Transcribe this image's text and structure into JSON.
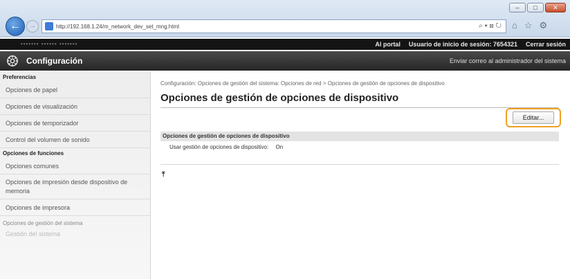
{
  "browser": {
    "url": "http://192.168.1.24/m_network_dev_set_mng.html",
    "addr_tools": "⌕ ▾ ⊠ ↻",
    "back_icon": "back-arrow-icon",
    "window_buttons": [
      "–",
      "□",
      "✕"
    ]
  },
  "topbar": {
    "device_name": "•••••••  •••••• •••••••",
    "portal_link": "Al portal",
    "login_user_label": "Usuario de inicio de sesión:",
    "login_user_value": "7654321",
    "logout_link": "Cerrar sesión"
  },
  "header": {
    "title": "Configuración",
    "mail_link": "Enviar correo al administrador del sistema"
  },
  "sidebar": {
    "group1": "Preferencias",
    "items1": [
      "Opciones de papel",
      "Opciones de visualización",
      "Opciones de temporizador",
      "Control del volumen de sonido"
    ],
    "group2": "Opciones de funciones",
    "items2": [
      "Opciones comunes",
      "Opciones de impresión desde dispositivo de memoria",
      "Opciones de impresora"
    ],
    "group3": "Opciones de gestión del sistema",
    "faded_item": "Gestión del sistema"
  },
  "main": {
    "breadcrumb": "Configuración: Opciones de gestión del sistema: Opciones de red > Opciones de gestión de opciones de dispositivo",
    "title": "Opciones de gestión de opciones de dispositivo",
    "edit_button": "Editar...",
    "section_title": "Opciones de gestión de opciones de dispositivo",
    "setting_label": "Usar gestión de opciones de dispositivo:",
    "setting_value": "On",
    "top_icon": "⤒"
  },
  "colors": {
    "highlight": "#f0a020",
    "header_bg": "#262626",
    "topbar_bg": "#141414"
  }
}
